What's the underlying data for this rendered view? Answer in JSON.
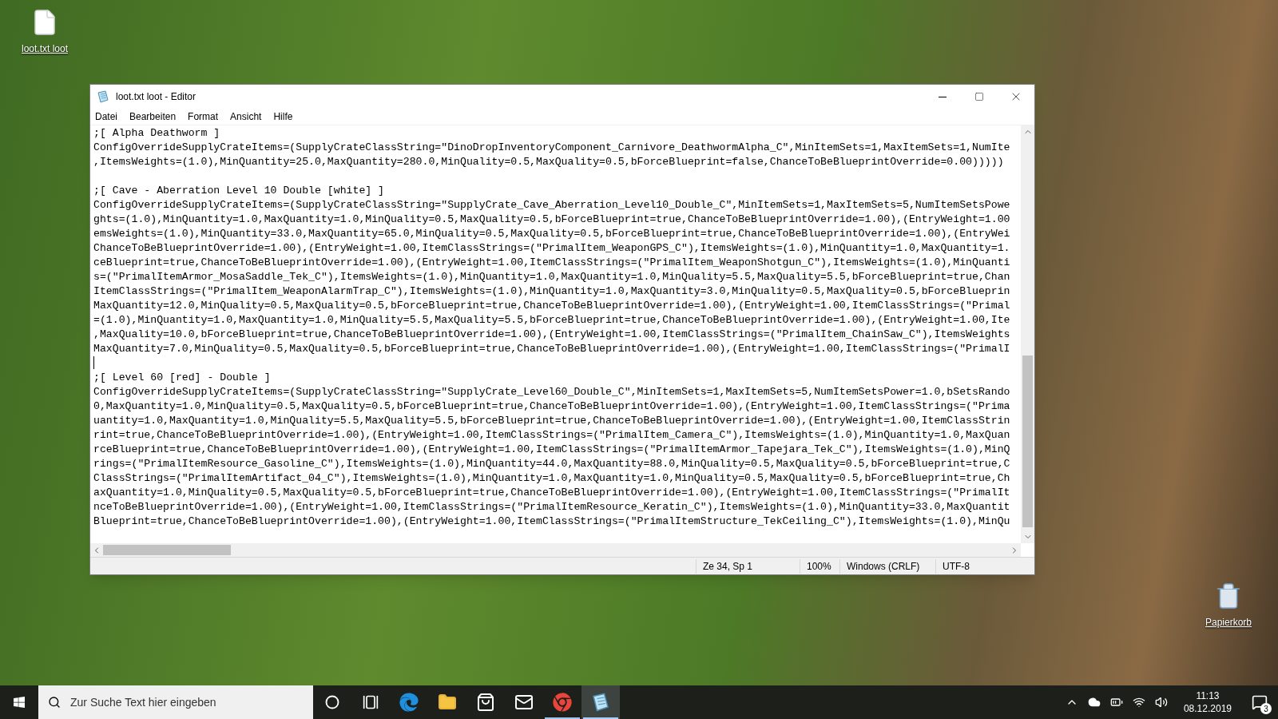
{
  "desktop_icons": [
    {
      "kind": "file",
      "label": "loot.txt loot"
    },
    {
      "kind": "recycle_bin",
      "label": "Papierkorb"
    }
  ],
  "window": {
    "title": "loot.txt loot - Editor",
    "menu": [
      "Datei",
      "Bearbeiten",
      "Format",
      "Ansicht",
      "Hilfe"
    ],
    "lines": [
      {
        "text": ";[ Alpha Deathworm ]",
        "caret": false
      },
      {
        "text": "ConfigOverrideSupplyCrateItems=(SupplyCrateClassString=\"DinoDropInventoryComponent_Carnivore_DeathwormAlpha_C\",MinItemSets=1,MaxItemSets=1,NumIte",
        "caret": false
      },
      {
        "text": ",ItemsWeights=(1.0),MinQuantity=25.0,MaxQuantity=280.0,MinQuality=0.5,MaxQuality=0.5,bForceBlueprint=false,ChanceToBeBlueprintOverride=0.00)))))",
        "caret": false
      },
      {
        "caret": false
      },
      {
        "text": ";[ Cave - Aberration Level 10 Double [white] ]",
        "caret": false
      },
      {
        "text": "ConfigOverrideSupplyCrateItems=(SupplyCrateClassString=\"SupplyCrate_Cave_Aberration_Level10_Double_C\",MinItemSets=1,MaxItemSets=5,NumItemSetsPowe",
        "caret": false
      },
      {
        "text": "ghts=(1.0),MinQuantity=1.0,MaxQuantity=1.0,MinQuality=0.5,MaxQuality=0.5,bForceBlueprint=true,ChanceToBeBlueprintOverride=1.00),(EntryWeight=1.00",
        "caret": false
      },
      {
        "text": "emsWeights=(1.0),MinQuantity=33.0,MaxQuantity=65.0,MinQuality=0.5,MaxQuality=0.5,bForceBlueprint=true,ChanceToBeBlueprintOverride=1.00),(EntryWei",
        "caret": false
      },
      {
        "text": "ChanceToBeBlueprintOverride=1.00),(EntryWeight=1.00,ItemClassStrings=(\"PrimalItem_WeaponGPS_C\"),ItemsWeights=(1.0),MinQuantity=1.0,MaxQuantity=1.",
        "caret": false
      },
      {
        "text": "ceBlueprint=true,ChanceToBeBlueprintOverride=1.00),(EntryWeight=1.00,ItemClassStrings=(\"PrimalItem_WeaponShotgun_C\"),ItemsWeights=(1.0),MinQuanti",
        "caret": false
      },
      {
        "text": "s=(\"PrimalItemArmor_MosaSaddle_Tek_C\"),ItemsWeights=(1.0),MinQuantity=1.0,MaxQuantity=1.0,MinQuality=5.5,MaxQuality=5.5,bForceBlueprint=true,Chan",
        "caret": false
      },
      {
        "text": "ItemClassStrings=(\"PrimalItem_WeaponAlarmTrap_C\"),ItemsWeights=(1.0),MinQuantity=1.0,MaxQuantity=3.0,MinQuality=0.5,MaxQuality=0.5,bForceBlueprin",
        "caret": false
      },
      {
        "text": "MaxQuantity=12.0,MinQuality=0.5,MaxQuality=0.5,bForceBlueprint=true,ChanceToBeBlueprintOverride=1.00),(EntryWeight=1.00,ItemClassStrings=(\"Primal",
        "caret": false
      },
      {
        "text": "=(1.0),MinQuantity=1.0,MaxQuantity=1.0,MinQuality=5.5,MaxQuality=5.5,bForceBlueprint=true,ChanceToBeBlueprintOverride=1.00),(EntryWeight=1.00,Ite",
        "caret": false
      },
      {
        "text": ",MaxQuality=10.0,bForceBlueprint=true,ChanceToBeBlueprintOverride=1.00),(EntryWeight=1.00,ItemClassStrings=(\"PrimalItem_ChainSaw_C\"),ItemsWeights",
        "caret": false
      },
      {
        "text": "MaxQuantity=7.0,MinQuality=0.5,MaxQuality=0.5,bForceBlueprint=true,ChanceToBeBlueprintOverride=1.00),(EntryWeight=1.00,ItemClassStrings=(\"PrimalI",
        "caret": false
      },
      {
        "caret": true
      },
      {
        "text": ";[ Level 60 [red] - Double ]",
        "caret": false
      },
      {
        "text": "ConfigOverrideSupplyCrateItems=(SupplyCrateClassString=\"SupplyCrate_Level60_Double_C\",MinItemSets=1,MaxItemSets=5,NumItemSetsPower=1.0,bSetsRando",
        "caret": false
      },
      {
        "text": "0,MaxQuantity=1.0,MinQuality=0.5,MaxQuality=0.5,bForceBlueprint=true,ChanceToBeBlueprintOverride=1.00),(EntryWeight=1.00,ItemClassStrings=(\"Prima",
        "caret": false
      },
      {
        "text": "uantity=1.0,MaxQuantity=1.0,MinQuality=5.5,MaxQuality=5.5,bForceBlueprint=true,ChanceToBeBlueprintOverride=1.00),(EntryWeight=1.00,ItemClassStrin",
        "caret": false
      },
      {
        "text": "rint=true,ChanceToBeBlueprintOverride=1.00),(EntryWeight=1.00,ItemClassStrings=(\"PrimalItem_Camera_C\"),ItemsWeights=(1.0),MinQuantity=1.0,MaxQuan",
        "caret": false
      },
      {
        "text": "rceBlueprint=true,ChanceToBeBlueprintOverride=1.00),(EntryWeight=1.00,ItemClassStrings=(\"PrimalItemArmor_Tapejara_Tek_C\"),ItemsWeights=(1.0),MinQ",
        "caret": false
      },
      {
        "text": "rings=(\"PrimalItemResource_Gasoline_C\"),ItemsWeights=(1.0),MinQuantity=44.0,MaxQuantity=88.0,MinQuality=0.5,MaxQuality=0.5,bForceBlueprint=true,C",
        "caret": false
      },
      {
        "text": "ClassStrings=(\"PrimalItemArtifact_04_C\"),ItemsWeights=(1.0),MinQuantity=1.0,MaxQuantity=1.0,MinQuality=0.5,MaxQuality=0.5,bForceBlueprint=true,Ch",
        "caret": false
      },
      {
        "text": "axQuantity=1.0,MinQuality=0.5,MaxQuality=0.5,bForceBlueprint=true,ChanceToBeBlueprintOverride=1.00),(EntryWeight=1.00,ItemClassStrings=(\"PrimalIt",
        "caret": false
      },
      {
        "text": "nceToBeBlueprintOverride=1.00),(EntryWeight=1.00,ItemClassStrings=(\"PrimalItemResource_Keratin_C\"),ItemsWeights=(1.0),MinQuantity=33.0,MaxQuantit",
        "caret": false
      },
      {
        "text": "Blueprint=true,ChanceToBeBlueprintOverride=1.00),(EntryWeight=1.00,ItemClassStrings=(\"PrimalItemStructure_TekCeiling_C\"),ItemsWeights=(1.0),MinQu",
        "caret": false
      }
    ],
    "status_bar": {
      "position": "Ze 34, Sp 1",
      "zoom": "100%",
      "line_ending": "Windows (CRLF)",
      "encoding": "UTF-8"
    }
  },
  "taskbar": {
    "search": {
      "placeholder": "Zur Suche Text hier eingeben"
    },
    "apps": [
      {
        "kind": "cortana",
        "running": false,
        "selected": false
      },
      {
        "kind": "task_view",
        "running": false,
        "selected": false
      },
      {
        "kind": "edge",
        "running": false,
        "selected": false
      },
      {
        "kind": "explorer",
        "running": false,
        "selected": false
      },
      {
        "kind": "store",
        "running": false,
        "selected": false
      },
      {
        "kind": "mail",
        "running": false,
        "selected": false
      },
      {
        "kind": "chrome",
        "running": true,
        "selected": false
      },
      {
        "kind": "notepad",
        "running": true,
        "selected": true
      }
    ],
    "time": "11:13",
    "date": "08.12.2019",
    "notification_count": "3"
  }
}
